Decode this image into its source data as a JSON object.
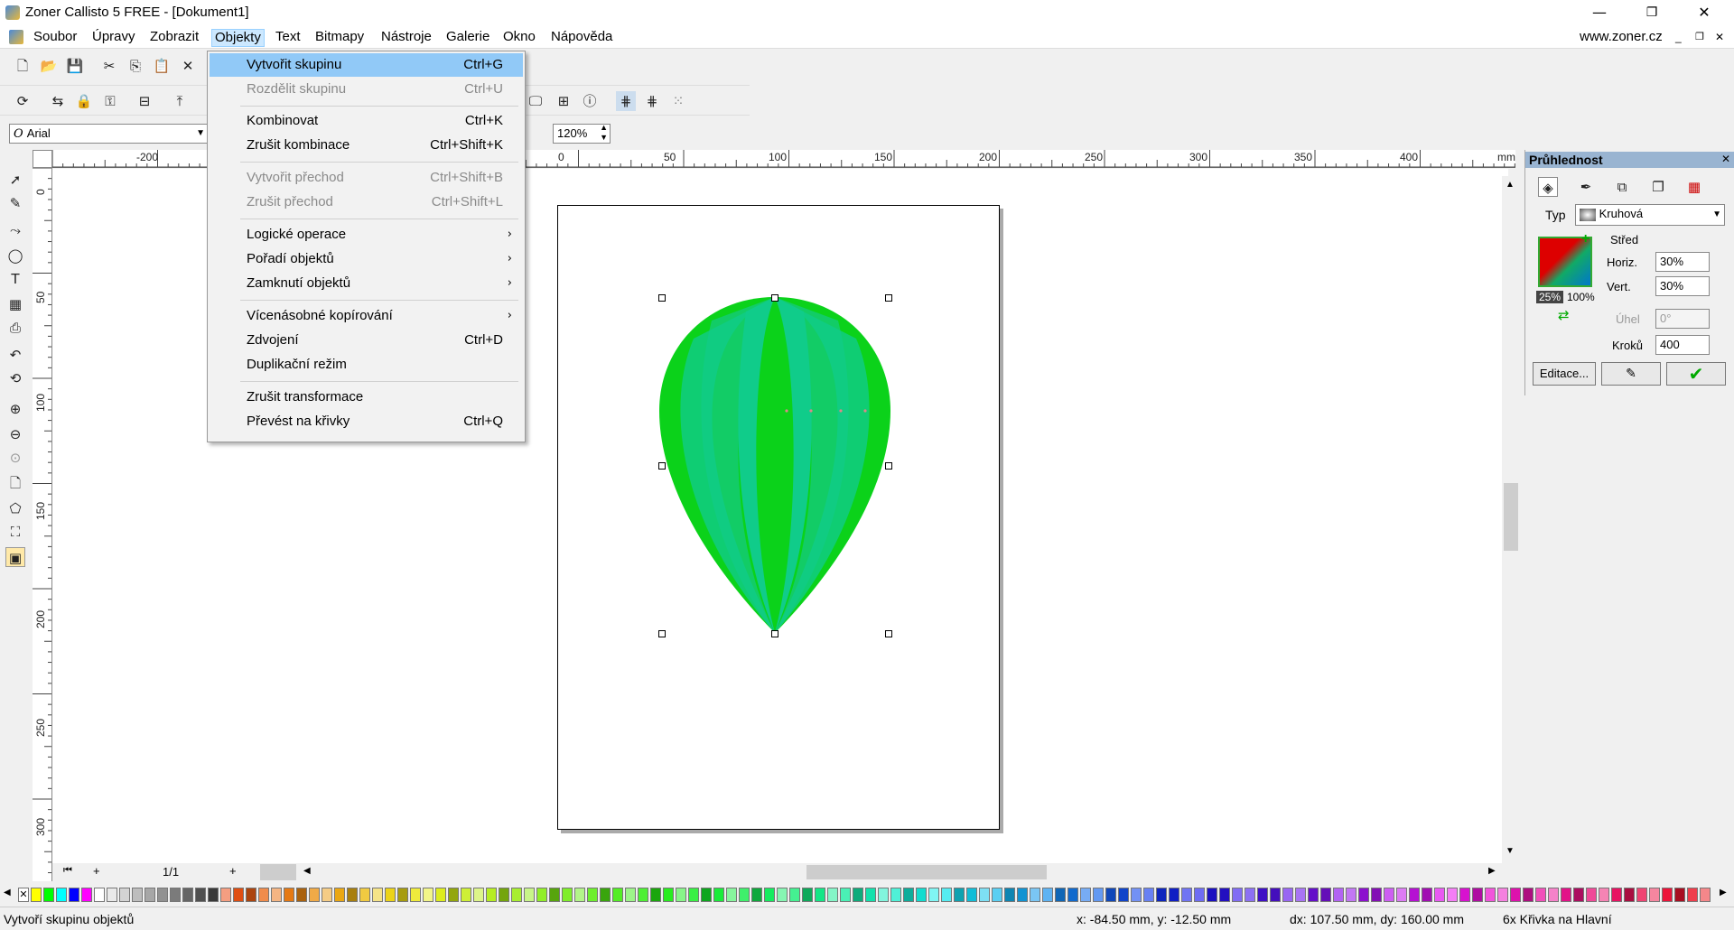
{
  "window": {
    "title": "Zoner Callisto 5 FREE - [Dokument1]",
    "minimize": "—",
    "restore": "❐",
    "close": "✕"
  },
  "menubar": {
    "items": [
      "Soubor",
      "Úpravy",
      "Zobrazit",
      "Objekty",
      "Text",
      "Bitmapy",
      "Nástroje",
      "Galerie",
      "Okno",
      "Nápověda"
    ],
    "active": "Objekty",
    "website": "www.zoner.cz"
  },
  "toolbar": {
    "font": "Arial",
    "zoom": "120%"
  },
  "ruler": {
    "h_labels": [
      "-200",
      "0",
      "50",
      "100",
      "150",
      "200",
      "250",
      "300",
      "350",
      "400",
      "mm"
    ],
    "v_labels": [
      "0",
      "50",
      "100",
      "150",
      "200",
      "250",
      "300"
    ]
  },
  "objects_menu": {
    "items": [
      {
        "label": "Vytvořit skupinu",
        "shortcut": "Ctrl+G",
        "state": "highlighted"
      },
      {
        "label": "Rozdělit skupinu",
        "shortcut": "Ctrl+U",
        "state": "disabled"
      },
      {
        "label": "Kombinovat",
        "shortcut": "Ctrl+K",
        "state": "enabled"
      },
      {
        "label": "Zrušit kombinace",
        "shortcut": "Ctrl+Shift+K",
        "state": "enabled"
      },
      {
        "label": "Vytvořit přechod",
        "shortcut": "Ctrl+Shift+B",
        "state": "disabled"
      },
      {
        "label": "Zrušit přechod",
        "shortcut": "Ctrl+Shift+L",
        "state": "disabled"
      },
      {
        "label": "Logické operace",
        "shortcut": "",
        "submenu": true,
        "state": "enabled"
      },
      {
        "label": "Pořadí  objektů",
        "shortcut": "",
        "submenu": true,
        "state": "enabled"
      },
      {
        "label": "Zamknutí objektů",
        "shortcut": "",
        "submenu": true,
        "state": "enabled"
      },
      {
        "label": "Vícenásobné kopírování",
        "shortcut": "",
        "submenu": true,
        "state": "enabled"
      },
      {
        "label": "Zdvojení",
        "shortcut": "Ctrl+D",
        "state": "enabled"
      },
      {
        "label": "Duplikační režim",
        "shortcut": "",
        "state": "enabled"
      },
      {
        "label": "Zrušit transformace",
        "shortcut": "",
        "state": "enabled"
      },
      {
        "label": "Převést na křivky",
        "shortcut": "Ctrl+Q",
        "state": "enabled"
      }
    ]
  },
  "panel": {
    "title": "Průhlednost",
    "type_label": "Typ",
    "type_value": "Kruhová",
    "center_label": "Střed",
    "horiz_label": "Horiz.",
    "horiz_value": "30%",
    "vert_label": "Vert.",
    "vert_value": "30%",
    "angle_label": "Úhel",
    "angle_value": "0°",
    "steps_label": "Kroků",
    "steps_value": "400",
    "pct_start": "25%",
    "pct_end": "100%",
    "edit_button": "Editace..."
  },
  "scroll": {
    "page_indicator": "1/1"
  },
  "status": {
    "hint": "Vytvoří skupinu objektů",
    "coords": "x: -84.50 mm, y: -12.50 mm",
    "size": "dx: 107.50 mm, dy: 160.00 mm",
    "selection": "6x Křivka na Hlavní"
  },
  "colors": {
    "balloon_a": "#0bd21a",
    "balloon_b": "#12cc66",
    "balloon_c": "#10cc8a",
    "menu_highlight": "#91c9f7"
  }
}
